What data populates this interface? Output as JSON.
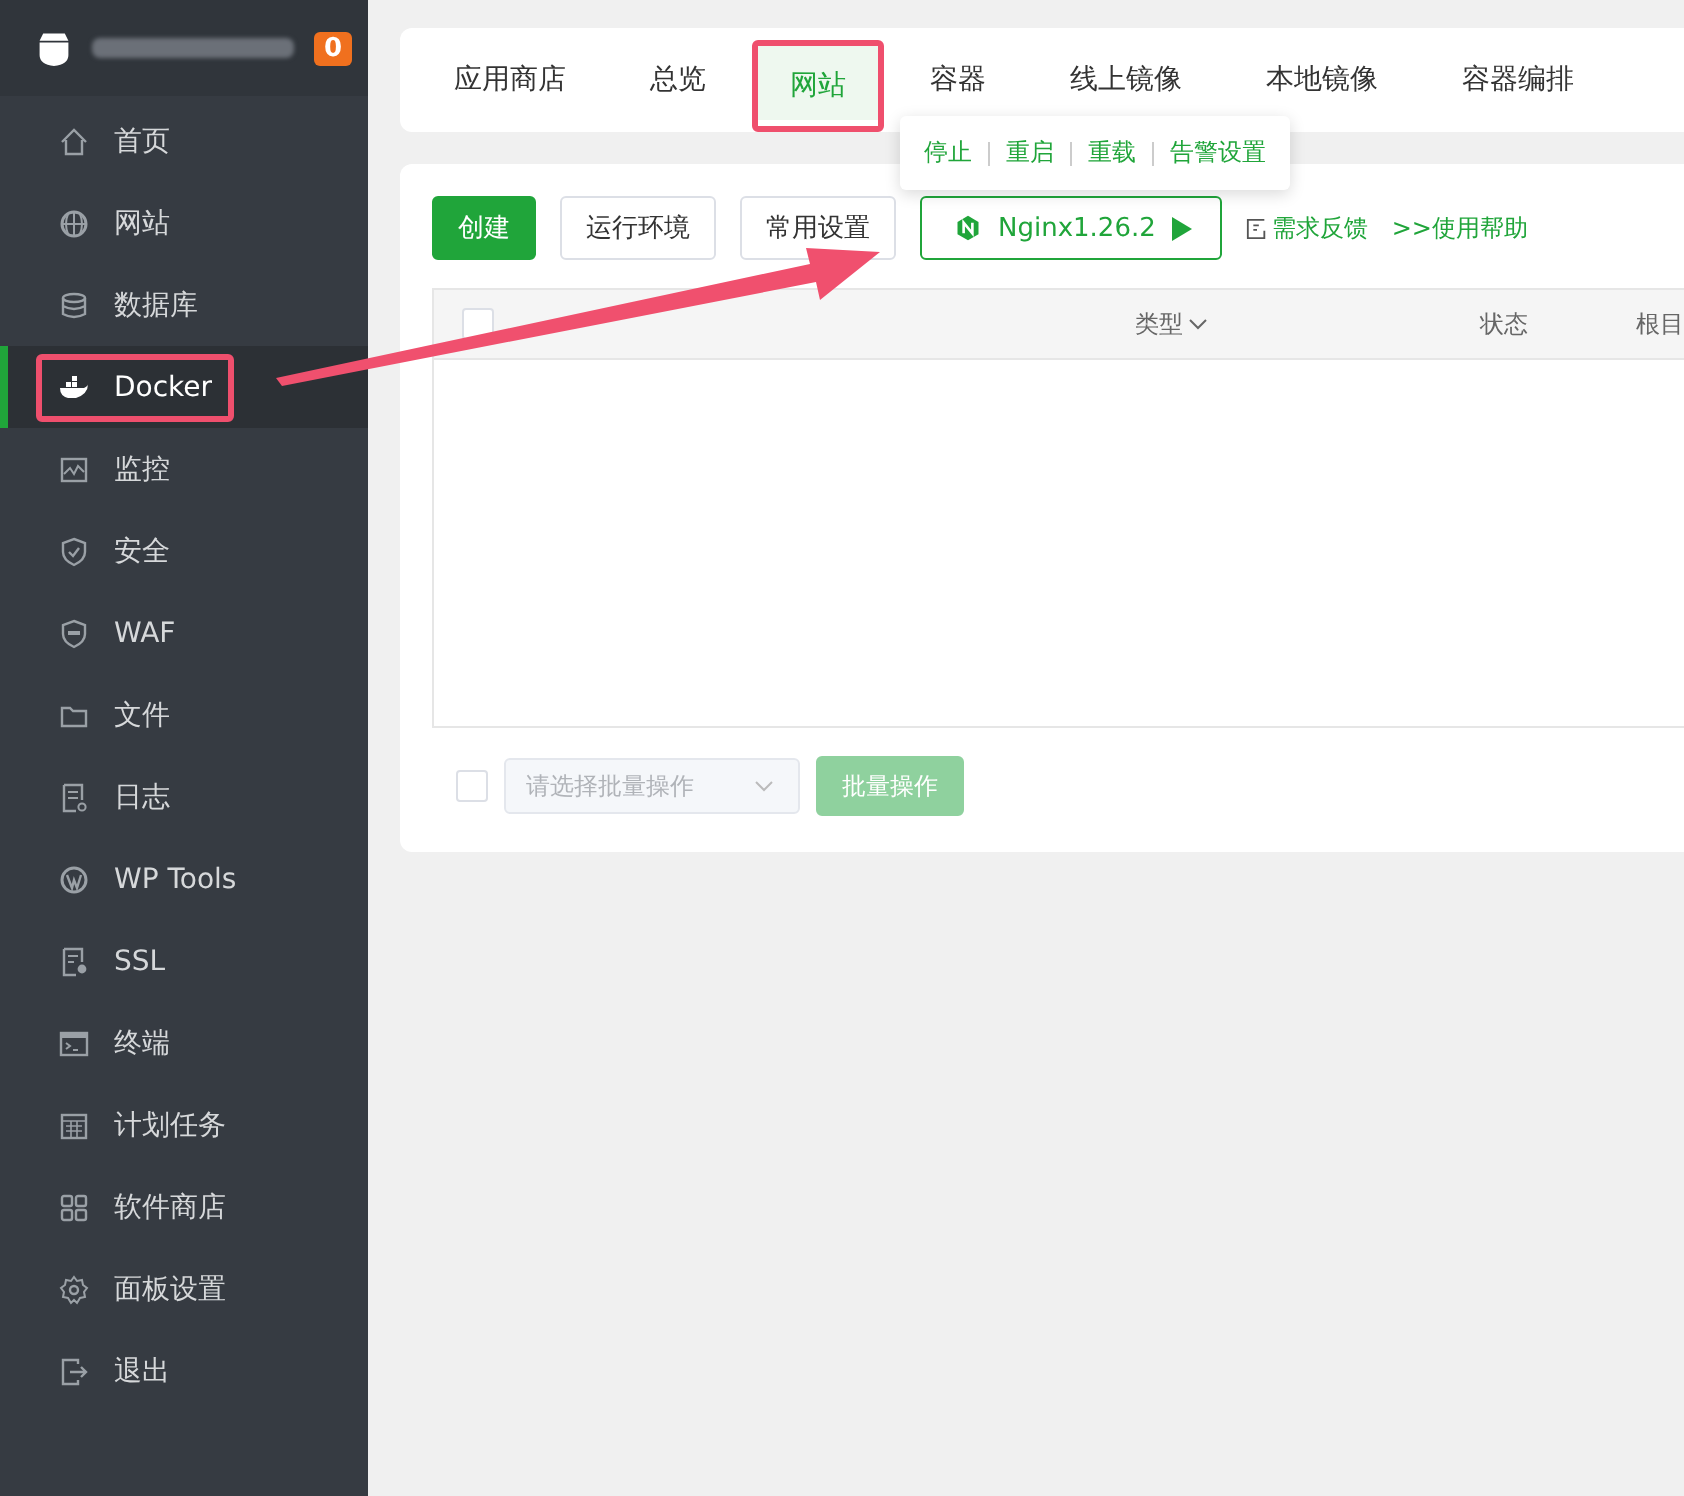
{
  "sidebar": {
    "badge": "0",
    "items": [
      {
        "label": "首页",
        "selected": false,
        "highlighted": false
      },
      {
        "label": "网站",
        "selected": false,
        "highlighted": false
      },
      {
        "label": "数据库",
        "selected": false,
        "highlighted": false
      },
      {
        "label": "Docker",
        "selected": true,
        "highlighted": true
      },
      {
        "label": "监控",
        "selected": false,
        "highlighted": false
      },
      {
        "label": "安全",
        "selected": false,
        "highlighted": false
      },
      {
        "label": "WAF",
        "selected": false,
        "highlighted": false
      },
      {
        "label": "文件",
        "selected": false,
        "highlighted": false
      },
      {
        "label": "日志",
        "selected": false,
        "highlighted": false
      },
      {
        "label": "WP Tools",
        "selected": false,
        "highlighted": false
      },
      {
        "label": "SSL",
        "selected": false,
        "highlighted": false
      },
      {
        "label": "终端",
        "selected": false,
        "highlighted": false
      },
      {
        "label": "计划任务",
        "selected": false,
        "highlighted": false
      },
      {
        "label": "软件商店",
        "selected": false,
        "highlighted": false
      },
      {
        "label": "面板设置",
        "selected": false,
        "highlighted": false
      },
      {
        "label": "退出",
        "selected": false,
        "highlighted": false
      }
    ]
  },
  "tabs": [
    {
      "label": "应用商店",
      "selected": false,
      "highlighted": false
    },
    {
      "label": "总览",
      "selected": false,
      "highlighted": false
    },
    {
      "label": "网站",
      "selected": true,
      "highlighted": true
    },
    {
      "label": "容器",
      "selected": false,
      "highlighted": false
    },
    {
      "label": "线上镜像",
      "selected": false,
      "highlighted": false
    },
    {
      "label": "本地镜像",
      "selected": false,
      "highlighted": false
    },
    {
      "label": "容器编排",
      "selected": false,
      "highlighted": false
    }
  ],
  "popover": {
    "items": [
      "停止",
      "重启",
      "重载",
      "告警设置"
    ]
  },
  "toolbar": {
    "buttons": [
      {
        "label": "创建",
        "kind": "primary"
      },
      {
        "label": "运行环境",
        "kind": "default"
      },
      {
        "label": "常用设置",
        "kind": "default"
      },
      {
        "label": "Nginx1.26.2",
        "kind": "service"
      }
    ],
    "links": [
      "需求反馈",
      ">>使用帮助"
    ]
  },
  "table": {
    "checked": false,
    "columns": [
      {
        "label": "类型",
        "sortable": true
      },
      {
        "label": "状态",
        "sortable": false
      },
      {
        "label": "根目",
        "sortable": false
      }
    ]
  },
  "batch": {
    "checked": false,
    "placeholder": "请选择批量操作",
    "button": "批量操作",
    "disabled": true
  }
}
